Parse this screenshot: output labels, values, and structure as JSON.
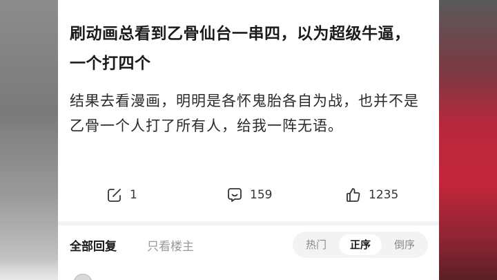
{
  "post": {
    "title": "刷动画总看到乙骨仙台一串四，以为超级牛逼，一个打四个",
    "body": "结果去看漫画，明明是各怀鬼胎各自为战，也并不是乙骨一个人打了所有人，给我一阵无语。"
  },
  "actions": {
    "share_count": "1",
    "comment_count": "159",
    "like_count": "1235"
  },
  "replies": {
    "tab_all": "全部回复",
    "tab_op_only": "只看楼主",
    "sort_hot": "热门",
    "sort_asc": "正序",
    "sort_desc": "倒序",
    "active_sort": "正序"
  },
  "colors": {
    "title": "#1a1a1a",
    "muted": "#999999",
    "sort_bg": "#f3f3f3"
  }
}
